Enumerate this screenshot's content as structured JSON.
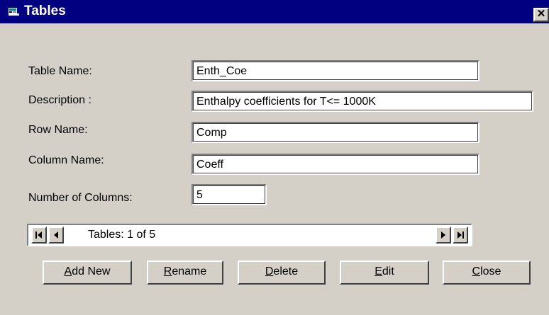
{
  "window": {
    "title": "Tables",
    "close_label": "✕"
  },
  "form": {
    "table_name_label": "Table Name:",
    "table_name_value": "Enth_Coe",
    "description_label": "Description :",
    "description_value": "Enthalpy coefficients for T<= 1000K",
    "row_name_label": "Row Name:",
    "row_name_value": "Comp",
    "column_name_label": "Column Name:",
    "column_name_value": "Coeff",
    "num_columns_label": "Number of Columns:",
    "num_columns_value": "5"
  },
  "navigator": {
    "caption": "Tables: 1 of 5",
    "first_icon": "first-record-icon",
    "prev_icon": "previous-record-icon",
    "next_icon": "next-record-icon",
    "last_icon": "last-record-icon"
  },
  "buttons": {
    "add_new": {
      "accel": "A",
      "rest": "dd New"
    },
    "rename": {
      "accel": "R",
      "rest": "ename"
    },
    "delete": {
      "accel": "D",
      "rest": "elete"
    },
    "edit": {
      "accel": "E",
      "rest": "dit"
    },
    "close": {
      "accel": "C",
      "rest": "lose"
    }
  },
  "colors": {
    "titlebar": "#000080",
    "face": "#d4d0c8"
  }
}
